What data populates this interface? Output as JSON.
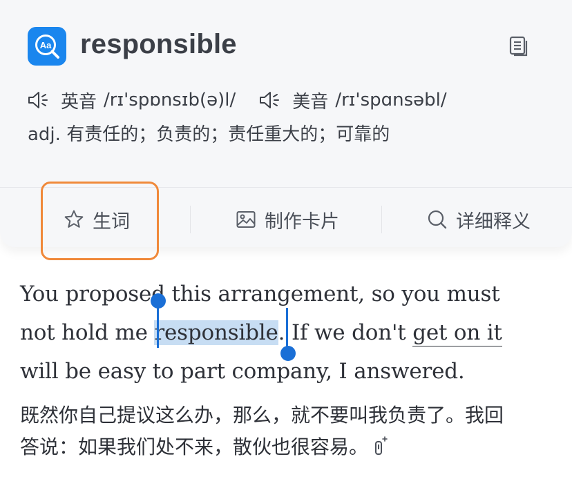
{
  "header": {
    "word": "responsible",
    "app_icon_text": "Aa"
  },
  "pronunciation": [
    {
      "label": "英音",
      "ipa": "/rɪ'spɒnsɪb(ə)l/"
    },
    {
      "label": "美音",
      "ipa": "/rɪ'spɑnsəbl/"
    }
  ],
  "definition": "adj. 有责任的；负责的；责任重大的；可靠的",
  "actions": {
    "vocab_label": "生词",
    "make_card_label": "制作卡片",
    "details_label": "详细释义"
  },
  "sentence": {
    "line1": "You proposed this arrangement, so you must",
    "line2_before": "not hold me ",
    "line2_selected": "responsible",
    "line2_middle": ". If we don't ",
    "line2_phrase": "get on it",
    "line3": "will be easy to part company, I answered."
  },
  "translation": {
    "line1": "既然你自己提议这么办，那么，就不要叫我负责了。我回",
    "line2": "答说：如果我们处不来，散伙也很容易。"
  },
  "colors": {
    "accent": "#1a86ee",
    "selection": "#c7ddf3",
    "handle": "#1a6fd6",
    "highlight_box": "#f0893a",
    "text": "#2e3138"
  }
}
